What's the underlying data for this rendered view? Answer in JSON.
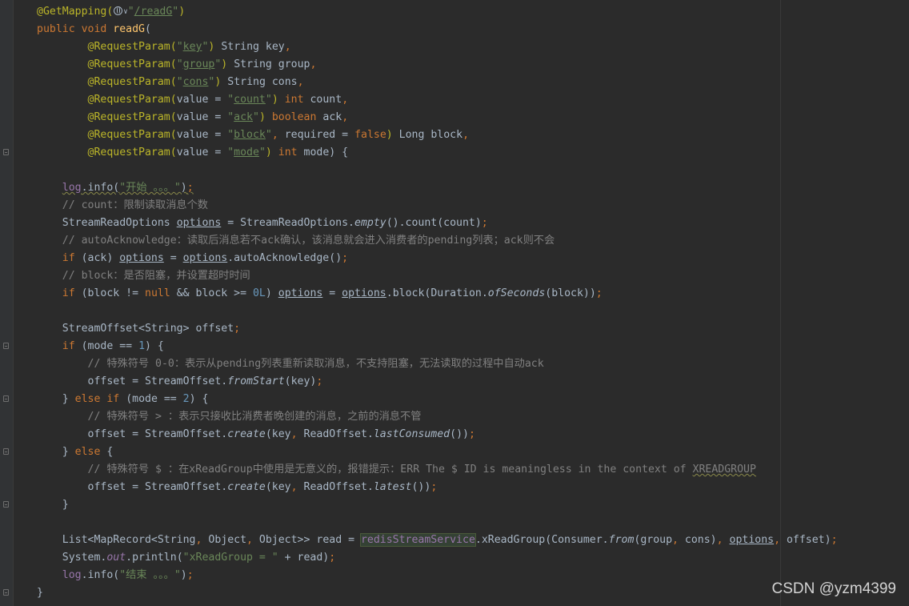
{
  "watermark": "CSDN @yzm4399",
  "lines": [
    [
      [
        "ann",
        "@GetMapping("
      ],
      [
        "globe",
        ""
      ],
      [
        "caret",
        "∨"
      ],
      [
        "str",
        "\""
      ],
      [
        "str ul",
        "/readG"
      ],
      [
        "str",
        "\""
      ],
      [
        "ann",
        ")"
      ]
    ],
    [
      [
        "kw",
        "public void "
      ],
      [
        "fn",
        "readG"
      ],
      [
        "p",
        "("
      ]
    ],
    [
      [
        "ind",
        "        "
      ],
      [
        "ann",
        "@RequestParam("
      ],
      [
        "str",
        "\""
      ],
      [
        "str ul",
        "key"
      ],
      [
        "str",
        "\""
      ],
      [
        "ann",
        ")"
      ],
      [
        "p",
        " String key"
      ],
      [
        "kw",
        ","
      ]
    ],
    [
      [
        "ind",
        "        "
      ],
      [
        "ann",
        "@RequestParam("
      ],
      [
        "str",
        "\""
      ],
      [
        "str ul",
        "group"
      ],
      [
        "str",
        "\""
      ],
      [
        "ann",
        ")"
      ],
      [
        "p",
        " String group"
      ],
      [
        "kw",
        ","
      ]
    ],
    [
      [
        "ind",
        "        "
      ],
      [
        "ann",
        "@RequestParam("
      ],
      [
        "str",
        "\""
      ],
      [
        "str ul",
        "cons"
      ],
      [
        "str",
        "\""
      ],
      [
        "ann",
        ")"
      ],
      [
        "p",
        " String cons"
      ],
      [
        "kw",
        ","
      ]
    ],
    [
      [
        "ind",
        "        "
      ],
      [
        "ann",
        "@RequestParam("
      ],
      [
        "p",
        "value = "
      ],
      [
        "str",
        "\""
      ],
      [
        "str ul",
        "count"
      ],
      [
        "str",
        "\""
      ],
      [
        "ann",
        ")"
      ],
      [
        "kw",
        " int "
      ],
      [
        "p",
        "count"
      ],
      [
        "kw",
        ","
      ]
    ],
    [
      [
        "ind",
        "        "
      ],
      [
        "ann",
        "@RequestParam("
      ],
      [
        "p",
        "value = "
      ],
      [
        "str",
        "\""
      ],
      [
        "str ul",
        "ack"
      ],
      [
        "str",
        "\""
      ],
      [
        "ann",
        ")"
      ],
      [
        "kw",
        " boolean "
      ],
      [
        "p",
        "ack"
      ],
      [
        "kw",
        ","
      ]
    ],
    [
      [
        "ind",
        "        "
      ],
      [
        "ann",
        "@RequestParam("
      ],
      [
        "p",
        "value = "
      ],
      [
        "str",
        "\""
      ],
      [
        "str ul",
        "block"
      ],
      [
        "str",
        "\""
      ],
      [
        "kw",
        ","
      ],
      [
        "p",
        " required = "
      ],
      [
        "kw",
        "false"
      ],
      [
        "ann",
        ")"
      ],
      [
        "p",
        " Long block"
      ],
      [
        "kw",
        ","
      ]
    ],
    [
      [
        "ind",
        "        "
      ],
      [
        "ann",
        "@RequestParam("
      ],
      [
        "p",
        "value = "
      ],
      [
        "str",
        "\""
      ],
      [
        "str ul",
        "mode"
      ],
      [
        "str",
        "\""
      ],
      [
        "ann",
        ")"
      ],
      [
        "kw",
        " int "
      ],
      [
        "p",
        "mode) {"
      ]
    ],
    [],
    [
      [
        "ind",
        "    "
      ],
      [
        "fld squig",
        "log"
      ],
      [
        "p squig",
        ".info("
      ],
      [
        "str squig",
        "\"开始 。。。\""
      ],
      [
        "p squig",
        ")"
      ],
      [
        "kw squig",
        ";"
      ]
    ],
    [
      [
        "ind",
        "    "
      ],
      [
        "cmt",
        "// count：限制读取消息个数"
      ]
    ],
    [
      [
        "ind",
        "    "
      ],
      [
        "p",
        "StreamReadOptions "
      ],
      [
        "p ul",
        "options"
      ],
      [
        "p",
        " = StreamReadOptions."
      ],
      [
        "p itf",
        "empty"
      ],
      [
        "p",
        "().count(count)"
      ],
      [
        "kw",
        ";"
      ]
    ],
    [
      [
        "ind",
        "    "
      ],
      [
        "cmt",
        "// autoAcknowledge：读取后消息若不ack确认，该消息就会进入消费者的pending列表；ack则不会"
      ]
    ],
    [
      [
        "ind",
        "    "
      ],
      [
        "kw",
        "if "
      ],
      [
        "p",
        "(ack) "
      ],
      [
        "p ul",
        "options"
      ],
      [
        "p",
        " = "
      ],
      [
        "p ul",
        "options"
      ],
      [
        "p",
        ".autoAcknowledge()"
      ],
      [
        "kw",
        ";"
      ]
    ],
    [
      [
        "ind",
        "    "
      ],
      [
        "cmt",
        "// block：是否阻塞，并设置超时时间"
      ]
    ],
    [
      [
        "ind",
        "    "
      ],
      [
        "kw",
        "if "
      ],
      [
        "p",
        "(block != "
      ],
      [
        "kw",
        "null "
      ],
      [
        "p",
        "&& block >= "
      ],
      [
        "num",
        "0L"
      ],
      [
        "p",
        ") "
      ],
      [
        "p ul",
        "options"
      ],
      [
        "p",
        " = "
      ],
      [
        "p ul",
        "options"
      ],
      [
        "p",
        ".block(Duration."
      ],
      [
        "p itf",
        "ofSeconds"
      ],
      [
        "p",
        "(block))"
      ],
      [
        "kw",
        ";"
      ]
    ],
    [],
    [
      [
        "ind",
        "    "
      ],
      [
        "p",
        "StreamOffset<String> offset"
      ],
      [
        "kw",
        ";"
      ]
    ],
    [
      [
        "ind",
        "    "
      ],
      [
        "kw",
        "if "
      ],
      [
        "p",
        "(mode == "
      ],
      [
        "num",
        "1"
      ],
      [
        "p",
        ") {"
      ]
    ],
    [
      [
        "ind",
        "        "
      ],
      [
        "cmt",
        "// 特殊符号 0-0：表示从pending列表重新读取消息，不支持阻塞，无法读取的过程中自动ack"
      ]
    ],
    [
      [
        "ind",
        "        "
      ],
      [
        "p",
        "offset = StreamOffset."
      ],
      [
        "p itf",
        "fromStart"
      ],
      [
        "p",
        "(key)"
      ],
      [
        "kw",
        ";"
      ]
    ],
    [
      [
        "ind",
        "    "
      ],
      [
        "p",
        "} "
      ],
      [
        "kw",
        "else if "
      ],
      [
        "p",
        "(mode == "
      ],
      [
        "num",
        "2"
      ],
      [
        "p",
        ") {"
      ]
    ],
    [
      [
        "ind",
        "        "
      ],
      [
        "cmt",
        "// 特殊符号 > ：表示只接收比消费者晚创建的消息，之前的消息不管"
      ]
    ],
    [
      [
        "ind",
        "        "
      ],
      [
        "p",
        "offset = StreamOffset."
      ],
      [
        "p itf",
        "create"
      ],
      [
        "p",
        "(key"
      ],
      [
        "kw",
        ", "
      ],
      [
        "p",
        "ReadOffset."
      ],
      [
        "p itf",
        "lastConsumed"
      ],
      [
        "p",
        "())"
      ],
      [
        "kw",
        ";"
      ]
    ],
    [
      [
        "ind",
        "    "
      ],
      [
        "p",
        "} "
      ],
      [
        "kw",
        "else "
      ],
      [
        "p",
        "{"
      ]
    ],
    [
      [
        "ind",
        "        "
      ],
      [
        "cmt",
        "// 特殊符号 $ ：在xReadGroup中使用是无意义的，报错提示：ERR The $ ID is meaningless in the context of "
      ],
      [
        "cmt squig",
        "XREADGROUP"
      ]
    ],
    [
      [
        "ind",
        "        "
      ],
      [
        "p",
        "offset = StreamOffset."
      ],
      [
        "p itf",
        "create"
      ],
      [
        "p",
        "(key"
      ],
      [
        "kw",
        ", "
      ],
      [
        "p",
        "ReadOffset."
      ],
      [
        "p itf",
        "latest"
      ],
      [
        "p",
        "())"
      ],
      [
        "kw",
        ";"
      ]
    ],
    [
      [
        "ind",
        "    "
      ],
      [
        "p",
        "}"
      ]
    ],
    [],
    [
      [
        "ind",
        "    "
      ],
      [
        "p",
        "List<MapRecord<String"
      ],
      [
        "kw",
        ", "
      ],
      [
        "p",
        "Object"
      ],
      [
        "kw",
        ", "
      ],
      [
        "p",
        "Object>> read = "
      ],
      [
        "fld hl",
        "redisStreamService"
      ],
      [
        "p",
        ".xReadGroup(Consumer."
      ],
      [
        "p itf",
        "from"
      ],
      [
        "p",
        "(group"
      ],
      [
        "kw",
        ", "
      ],
      [
        "p",
        "cons)"
      ],
      [
        "kw",
        ", "
      ],
      [
        "p ul",
        "options"
      ],
      [
        "kw",
        ", "
      ],
      [
        "p",
        "offset)"
      ],
      [
        "kw",
        ";"
      ]
    ],
    [
      [
        "ind",
        "    "
      ],
      [
        "p",
        "System."
      ],
      [
        "fld itf",
        "out"
      ],
      [
        "p",
        ".println("
      ],
      [
        "str",
        "\"xReadGroup = \""
      ],
      [
        "p",
        " + read)"
      ],
      [
        "kw",
        ";"
      ]
    ],
    [
      [
        "ind",
        "    "
      ],
      [
        "fld",
        "log"
      ],
      [
        "p",
        ".info("
      ],
      [
        "str",
        "\"结束 。。。\""
      ],
      [
        "p",
        ")"
      ],
      [
        "kw",
        ";"
      ]
    ],
    [
      [
        "p",
        "}"
      ]
    ]
  ]
}
